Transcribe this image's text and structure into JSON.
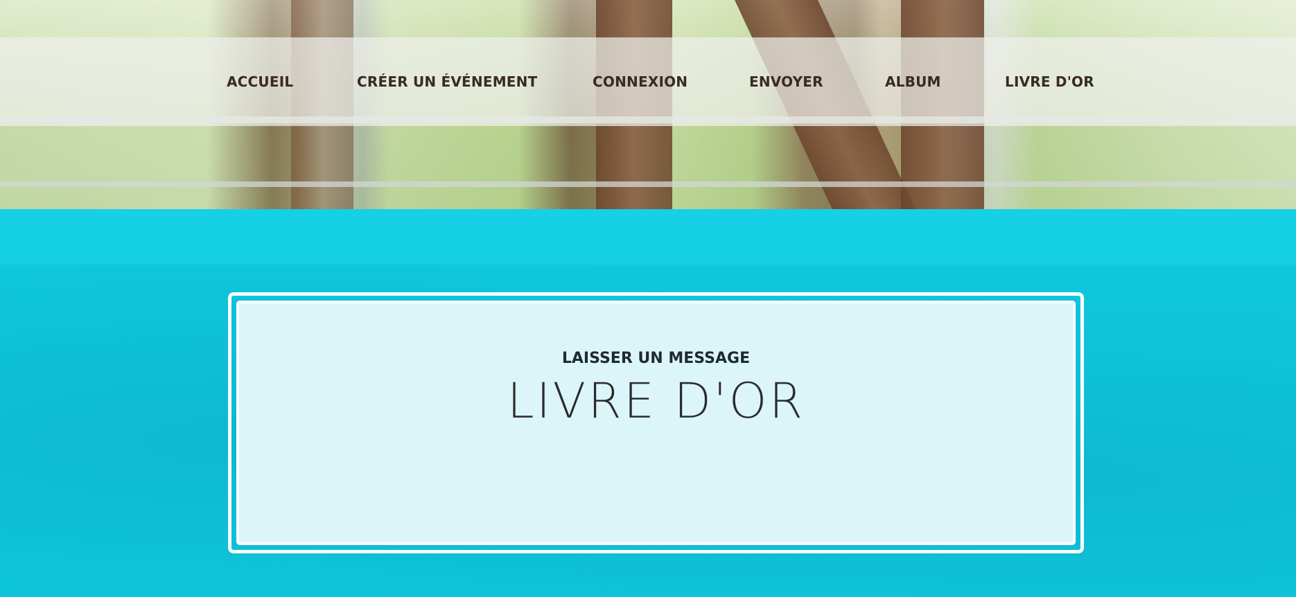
{
  "nav": {
    "items": [
      {
        "label": "ACCUEIL"
      },
      {
        "label": "CRÉER UN ÉVÉNEMENT"
      },
      {
        "label": "CONNEXION"
      },
      {
        "label": "ENVOYER"
      },
      {
        "label": "ALBUM"
      },
      {
        "label": "LIVRE D'OR"
      }
    ]
  },
  "section": {
    "eyebrow": "LAISSER UN MESSAGE",
    "title": "LIVRE D'OR"
  },
  "colors": {
    "accent": "#0fc7dd",
    "card": "#dcf5f9",
    "nav_text": "#3a2a22"
  }
}
